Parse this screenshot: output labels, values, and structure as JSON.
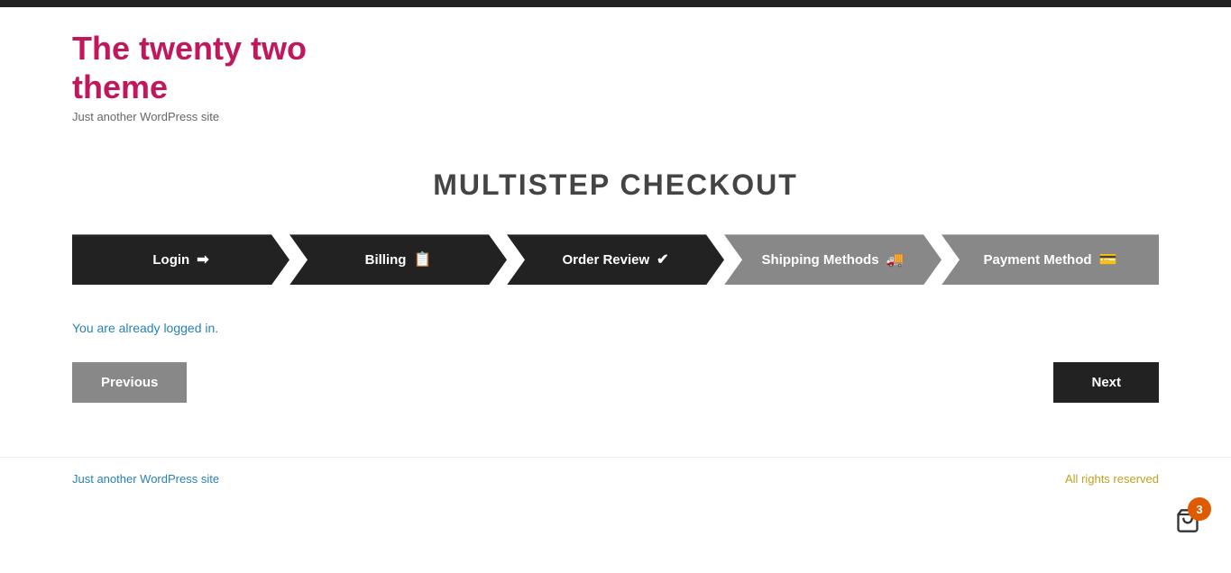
{
  "top_bar": {},
  "header": {
    "site_title_line1": "The twenty two",
    "site_title_line2": "theme",
    "site_tagline": "Just another WordPress site"
  },
  "main": {
    "checkout_title": "MULTISTEP CHECKOUT",
    "steps": [
      {
        "id": "login",
        "label": "Login",
        "icon": "→",
        "active": true
      },
      {
        "id": "billing",
        "label": "Billing",
        "icon": "☰",
        "active": true
      },
      {
        "id": "order-review",
        "label": "Order Review",
        "icon": "✔",
        "active": true
      },
      {
        "id": "shipping-methods",
        "label": "Shipping Methods",
        "icon": "🚚",
        "active": false
      },
      {
        "id": "payment-method",
        "label": "Payment Method",
        "icon": "💳",
        "active": false
      }
    ],
    "logged_in_message_prefix": "You are already logged in.",
    "btn_previous": "Previous",
    "btn_next": "Next"
  },
  "footer": {
    "left_text": "Just another WordPress site",
    "right_text": "All rights reserved"
  },
  "cart": {
    "count": "3"
  }
}
